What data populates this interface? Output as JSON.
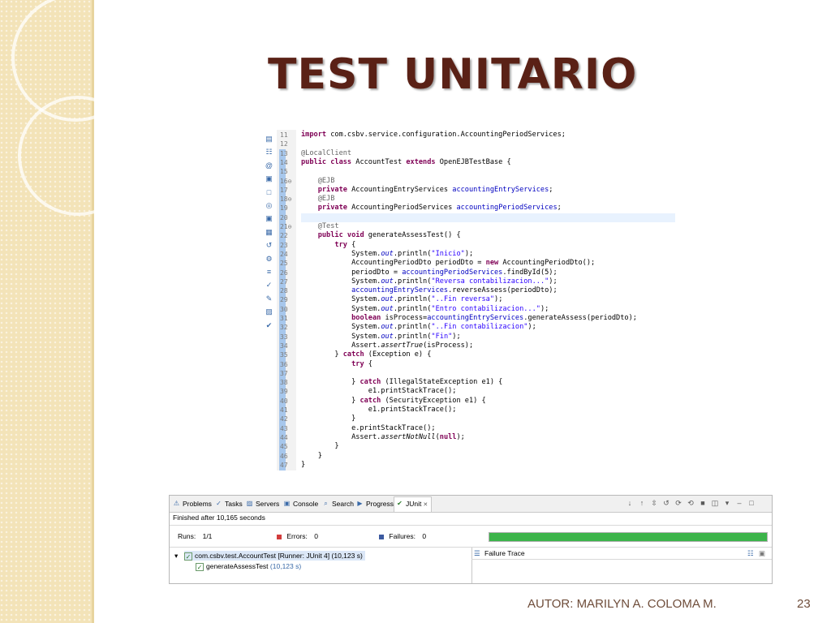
{
  "slide": {
    "title": "TEST UNITARIO",
    "footer_author": "AUTOR: MARILYN A. COLOMA M.",
    "page_number": "23"
  },
  "editor": {
    "lines": [
      {
        "n": "11",
        "segs": [
          {
            "c": "kw",
            "t": "import"
          },
          {
            "t": " com.csbv.service.configuration.AccountingPeriodServices;"
          }
        ]
      },
      {
        "n": "12",
        "segs": []
      },
      {
        "n": "13",
        "segs": [
          {
            "c": "ann",
            "t": "@LocalClient"
          }
        ]
      },
      {
        "n": "14",
        "segs": [
          {
            "c": "kw",
            "t": "public class"
          },
          {
            "t": " AccountTest "
          },
          {
            "c": "kw",
            "t": "extends"
          },
          {
            "t": " OpenEJBTestBase {"
          }
        ]
      },
      {
        "n": "15",
        "segs": []
      },
      {
        "n": "16⊖",
        "segs": [
          {
            "t": "    "
          },
          {
            "c": "ann",
            "t": "@EJB"
          }
        ]
      },
      {
        "n": "17",
        "segs": [
          {
            "t": "    "
          },
          {
            "c": "kw",
            "t": "private"
          },
          {
            "t": " AccountingEntryServices "
          },
          {
            "c": "fld",
            "t": "accountingEntryServices"
          },
          {
            "t": ";"
          }
        ]
      },
      {
        "n": "18⊖",
        "segs": [
          {
            "t": "    "
          },
          {
            "c": "ann",
            "t": "@EJB"
          }
        ]
      },
      {
        "n": "19",
        "segs": [
          {
            "t": "    "
          },
          {
            "c": "kw",
            "t": "private"
          },
          {
            "t": " AccountingPeriodServices "
          },
          {
            "c": "fld",
            "t": "accountingPeriodServices"
          },
          {
            "t": ";"
          }
        ]
      },
      {
        "n": "20",
        "segs": []
      },
      {
        "n": "21⊖",
        "segs": [
          {
            "t": "    "
          },
          {
            "c": "ann",
            "t": "@Test"
          }
        ]
      },
      {
        "n": "22",
        "segs": [
          {
            "t": "    "
          },
          {
            "c": "kw",
            "t": "public void"
          },
          {
            "t": " generateAssessTest() {"
          }
        ]
      },
      {
        "n": "23",
        "segs": [
          {
            "t": "        "
          },
          {
            "c": "kw",
            "t": "try"
          },
          {
            "t": " {"
          }
        ]
      },
      {
        "n": "24",
        "segs": [
          {
            "t": "            System."
          },
          {
            "c": "fld it",
            "t": "out"
          },
          {
            "t": ".println("
          },
          {
            "c": "str",
            "t": "\"Inicio\""
          },
          {
            "t": ");"
          }
        ]
      },
      {
        "n": "25",
        "segs": [
          {
            "t": "            AccountingPeriodDto periodDto = "
          },
          {
            "c": "kw",
            "t": "new"
          },
          {
            "t": " AccountingPeriodDto();"
          }
        ]
      },
      {
        "n": "26",
        "segs": [
          {
            "t": "            periodDto = "
          },
          {
            "c": "fld",
            "t": "accountingPeriodServices"
          },
          {
            "t": ".findById(5);"
          }
        ]
      },
      {
        "n": "27",
        "segs": [
          {
            "t": "            System."
          },
          {
            "c": "fld it",
            "t": "out"
          },
          {
            "t": ".println("
          },
          {
            "c": "str",
            "t": "\"Reversa contabilizacion...\""
          },
          {
            "t": ");"
          }
        ]
      },
      {
        "n": "28",
        "segs": [
          {
            "t": "            "
          },
          {
            "c": "fld",
            "t": "accountingEntryServices"
          },
          {
            "t": ".reverseAssess(periodDto);"
          }
        ]
      },
      {
        "n": "29",
        "segs": [
          {
            "t": "            System."
          },
          {
            "c": "fld it",
            "t": "out"
          },
          {
            "t": ".println("
          },
          {
            "c": "str",
            "t": "\"..Fin reversa\""
          },
          {
            "t": ");"
          }
        ]
      },
      {
        "n": "30",
        "segs": [
          {
            "t": "            System."
          },
          {
            "c": "fld it",
            "t": "out"
          },
          {
            "t": ".println("
          },
          {
            "c": "str",
            "t": "\"Entro contabilizacion...\""
          },
          {
            "t": ");"
          }
        ]
      },
      {
        "n": "31",
        "segs": [
          {
            "t": "            "
          },
          {
            "c": "kw",
            "t": "boolean"
          },
          {
            "t": " isProcess="
          },
          {
            "c": "fld",
            "t": "accountingEntryServices"
          },
          {
            "t": ".generateAssess(periodDto);"
          }
        ]
      },
      {
        "n": "32",
        "segs": [
          {
            "t": "            System."
          },
          {
            "c": "fld it",
            "t": "out"
          },
          {
            "t": ".println("
          },
          {
            "c": "str",
            "t": "\"..Fin contabilizacion\""
          },
          {
            "t": ");"
          }
        ]
      },
      {
        "n": "33",
        "segs": [
          {
            "t": "            System."
          },
          {
            "c": "fld it",
            "t": "out"
          },
          {
            "t": ".println("
          },
          {
            "c": "str",
            "t": "\"Fin\""
          },
          {
            "t": ");"
          }
        ]
      },
      {
        "n": "34",
        "segs": [
          {
            "t": "            Assert."
          },
          {
            "c": "it",
            "t": "assertTrue"
          },
          {
            "t": "(isProcess);"
          }
        ]
      },
      {
        "n": "35",
        "segs": [
          {
            "t": "        } "
          },
          {
            "c": "kw",
            "t": "catch"
          },
          {
            "t": " (Exception e) {"
          }
        ]
      },
      {
        "n": "36",
        "segs": [
          {
            "t": "            "
          },
          {
            "c": "kw",
            "t": "try"
          },
          {
            "t": " {"
          }
        ]
      },
      {
        "n": "37",
        "segs": []
      },
      {
        "n": "38",
        "segs": [
          {
            "t": "            } "
          },
          {
            "c": "kw",
            "t": "catch"
          },
          {
            "t": " (IllegalStateException e1) {"
          }
        ]
      },
      {
        "n": "39",
        "segs": [
          {
            "t": "                e1.printStackTrace();"
          }
        ]
      },
      {
        "n": "40",
        "segs": [
          {
            "t": "            } "
          },
          {
            "c": "kw",
            "t": "catch"
          },
          {
            "t": " (SecurityException e1) {"
          }
        ]
      },
      {
        "n": "41",
        "segs": [
          {
            "t": "                e1.printStackTrace();"
          }
        ]
      },
      {
        "n": "42",
        "segs": [
          {
            "t": "            }"
          }
        ]
      },
      {
        "n": "43",
        "segs": [
          {
            "t": "            e.printStackTrace();"
          }
        ]
      },
      {
        "n": "44",
        "segs": [
          {
            "t": "            Assert."
          },
          {
            "c": "it",
            "t": "assertNotNull"
          },
          {
            "t": "("
          },
          {
            "c": "kw",
            "t": "null"
          },
          {
            "t": ");"
          }
        ]
      },
      {
        "n": "45",
        "segs": [
          {
            "t": "        }"
          }
        ]
      },
      {
        "n": "46",
        "segs": [
          {
            "t": "    }"
          }
        ]
      },
      {
        "n": "47",
        "segs": [
          {
            "t": "}"
          }
        ]
      }
    ],
    "highlighted_line": "20",
    "side_icons": [
      "outline-icon",
      "hierarchy-icon",
      "javadoc-icon",
      "console-icon",
      "window-icon",
      "globe-icon",
      "console-icon",
      "coverage-icon",
      "history-icon",
      "debug-icon",
      "expressions-icon",
      "tasks-icon",
      "pin-icon",
      "servers-icon",
      "junit-icon"
    ]
  },
  "junit": {
    "tabs": [
      {
        "label": "Problems",
        "icon": "problems-icon"
      },
      {
        "label": "Tasks",
        "icon": "tasks-icon"
      },
      {
        "label": "Servers",
        "icon": "servers-icon"
      },
      {
        "label": "Console",
        "icon": "console-icon"
      },
      {
        "label": "Search",
        "icon": "search-icon"
      },
      {
        "label": "Progress",
        "icon": "progress-icon"
      },
      {
        "label": "JUnit",
        "icon": "junit-icon",
        "active": true
      }
    ],
    "close_glyph": "✕",
    "finished": "Finished after 10,165 seconds",
    "runs_label": "Runs:",
    "runs_value": "1/1",
    "errors_label": "Errors:",
    "errors_value": "0",
    "failures_label": "Failures:",
    "failures_value": "0",
    "progress_fraction": 1.0,
    "colors": {
      "success": "#3cb44a",
      "error": "#d23c3c",
      "failure": "#3c5aa0"
    },
    "tree": {
      "suite_label": "com.csbv.test.AccountTest [Runner: JUnit 4]",
      "suite_time": "(10,123 s)",
      "test_label": "generateAssessTest",
      "test_time": "(10,123 s)"
    },
    "failure_trace_label": "Failure Trace",
    "toolbar_icons": [
      "down-arrow-icon",
      "up-arrow-icon",
      "scroll-lock-icon",
      "history-icon",
      "rerun-icon",
      "rerun-failed-icon",
      "stop-icon",
      "layout-icon",
      "menu-icon",
      "minimize-icon",
      "maximize-icon"
    ]
  }
}
